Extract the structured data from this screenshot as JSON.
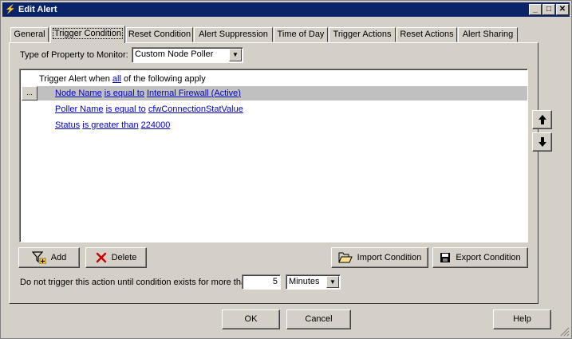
{
  "window": {
    "title": "Edit Alert"
  },
  "tabs": [
    {
      "label": "General"
    },
    {
      "label": "Trigger Condition",
      "active": true
    },
    {
      "label": "Reset Condition"
    },
    {
      "label": "Alert Suppression"
    },
    {
      "label": "Time of Day"
    },
    {
      "label": "Trigger Actions"
    },
    {
      "label": "Reset Actions"
    },
    {
      "label": "Alert Sharing"
    }
  ],
  "property": {
    "label": "Type of Property to Monitor:",
    "value": "Custom Node Poller"
  },
  "conditions": {
    "header_prefix": "Trigger Alert when",
    "header_link": "all",
    "header_suffix": "of the following apply",
    "ellipsis_label": "...",
    "rows": [
      {
        "field": "Node Name",
        "operator": "is equal to",
        "value": "Internal Firewall (Active)"
      },
      {
        "field": "Poller Name",
        "operator": "is equal to",
        "value": "cfwConnectionStatValue"
      },
      {
        "field": "Status",
        "operator": "is greater than",
        "value": "224000"
      }
    ]
  },
  "buttons": {
    "add": "Add",
    "delete": "Delete",
    "import": "Import Condition",
    "export": "Export Condition",
    "ok": "OK",
    "cancel": "Cancel",
    "help": "Help"
  },
  "duration": {
    "label": "Do not trigger this action until condition exists for more than",
    "value": "5",
    "unit": "Minutes"
  },
  "colors": {
    "title_bar": "#0a246a",
    "selected_row": "#c0c0c0",
    "link": "#0000cc",
    "delete_icon": "#cc0000"
  }
}
